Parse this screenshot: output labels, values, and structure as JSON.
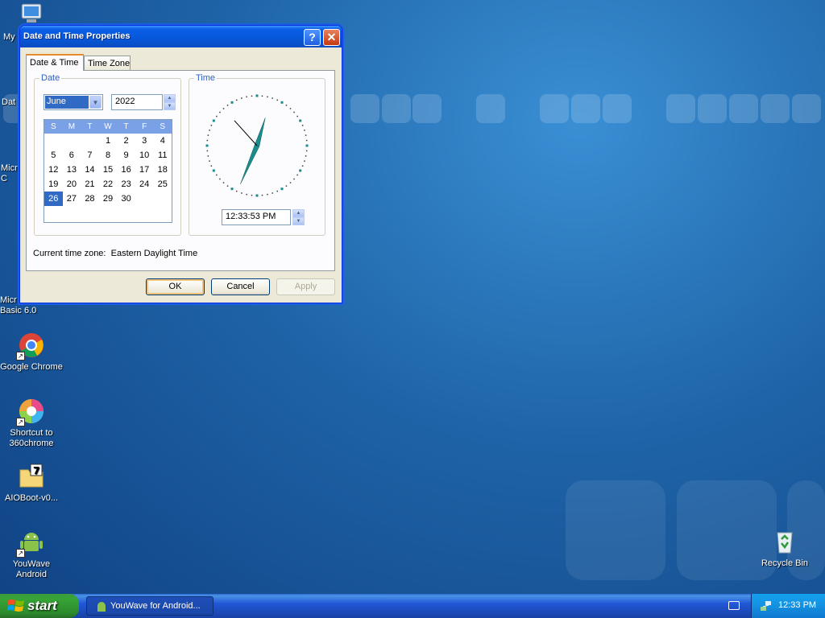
{
  "desktop": {
    "icons": [
      {
        "label": "My",
        "icon": "my-computer-icon"
      },
      {
        "label": "Dat",
        "icon": "date-icon"
      },
      {
        "label": "Micr\nC",
        "icon": "app-icon"
      },
      {
        "label": "Micr\nBasic 6.0",
        "icon": "vb-icon"
      },
      {
        "label": "Google Chrome",
        "icon": "chrome-icon"
      },
      {
        "label": "Shortcut to\n360chrome",
        "icon": "360chrome-icon"
      },
      {
        "label": "AIOBoot-v0...",
        "icon": "archive-icon"
      },
      {
        "label": "YouWave\nAndroid",
        "icon": "android-icon"
      },
      {
        "label": "Recycle Bin",
        "icon": "recycle-bin-icon"
      }
    ]
  },
  "dialog": {
    "title": "Date and Time Properties",
    "help_label": "?",
    "close_label": "✕",
    "tabs": [
      {
        "label": "Date & Time",
        "active": true
      },
      {
        "label": "Time Zone",
        "active": false
      }
    ],
    "date_group": {
      "title": "Date",
      "month": "June",
      "year": "2022",
      "weekdays": [
        "S",
        "M",
        "T",
        "W",
        "T",
        "F",
        "S"
      ],
      "weeks": [
        [
          "",
          "",
          "",
          "1",
          "2",
          "3",
          "4"
        ],
        [
          "5",
          "6",
          "7",
          "8",
          "9",
          "10",
          "11"
        ],
        [
          "12",
          "13",
          "14",
          "15",
          "16",
          "17",
          "18"
        ],
        [
          "19",
          "20",
          "21",
          "22",
          "23",
          "24",
          "25"
        ],
        [
          "26",
          "27",
          "28",
          "29",
          "30",
          "",
          ""
        ]
      ],
      "selected_day": "26"
    },
    "time_group": {
      "title": "Time",
      "time_value": "12:33:53 PM",
      "clock": {
        "hour": 12,
        "minute": 33,
        "second": 53,
        "hand_color": "#1a8c8c"
      }
    },
    "current_time_zone_label": "Current time zone:",
    "current_time_zone": "Eastern Daylight Time",
    "buttons": {
      "ok": "OK",
      "cancel": "Cancel",
      "apply": "Apply"
    }
  },
  "taskbar": {
    "start_label": "start",
    "task_button_label": "YouWave for Android...",
    "clock": "12:33 PM"
  }
}
